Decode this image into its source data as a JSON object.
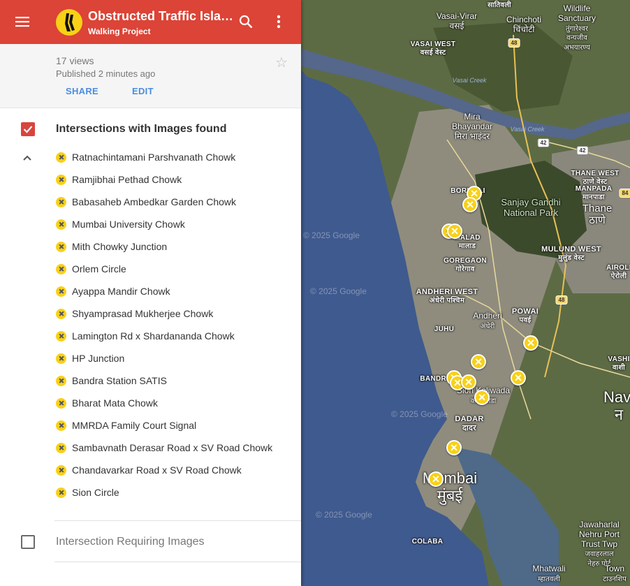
{
  "header": {
    "title": "Obstructed Traffic Isla…",
    "subtitle": "Walking Project",
    "menu_icon": "hamburger-menu-icon",
    "search_icon": "search-icon",
    "more_icon": "more-vert-icon",
    "color": "#db4437"
  },
  "info": {
    "views": "17 views",
    "published": "Published 2 minutes ago",
    "share_label": "SHARE",
    "edit_label": "EDIT",
    "star_icon": "star-outline-icon"
  },
  "layers": [
    {
      "title": "Intersections with Images found",
      "checked": true,
      "items": [
        "Ratnachintamani Parshvanath Chowk",
        "Ramjibhai Pethad Chowk",
        "Babasaheb Ambedkar Garden Chowk",
        "Mumbai University Chowk",
        "Mith Chowky Junction",
        "Orlem Circle",
        "Ayappa Mandir Chowk",
        "Shyamprasad Mukherjee Chowk",
        "Lamington Rd x Shardananda Chowk",
        "HP Junction",
        "Bandra Station SATIS",
        "Bharat Mata Chowk",
        "MMRDA Family Court Signal",
        "Sambavnath Derasar Road x SV Road Chowk",
        "Chandavarkar Road x SV Road Chowk",
        "Sion Circle"
      ]
    },
    {
      "title": "Intersection Requiring Images",
      "checked": false
    }
  ],
  "map": {
    "watermark": "© 2025 Google",
    "marker_color": "#f8d117",
    "places": {
      "vasai_virar": "Vasai-Virar",
      "vasai_virar_dev": "वसई",
      "satiwali": "सातिवली",
      "chinchoti": "Chinchoti",
      "chinchoti_dev": "चिंचोटी",
      "wildlife": "Wildlife",
      "sanctuary": "Sanctuary",
      "sanctuary_dev1": "तुंगारेश्वर",
      "sanctuary_dev2": "वन्यजीव",
      "sanctuary_dev3": "अभयारण्य",
      "vasai_west": "VASAI WEST",
      "vasai_west_dev": "वसई वेस्ट",
      "vasai_creek1": "Vasai Creek",
      "vasai_creek2": "Vasai Creek",
      "mira": "Mira",
      "bhayandar": "Bhayandar",
      "mira_dev": "मिरा भाइंदर",
      "thane_west": "THANE WEST",
      "thane_west_dev": "ठाणे वेस्ट",
      "manpada": "MANPADA",
      "manpada_dev": "मानपाडा",
      "sgnp1": "Sanjay Gandhi",
      "sgnp2": "National Park",
      "thane": "Thane",
      "thane_dev": "ठाणे",
      "borivali": "BORIVALI",
      "malad": "MALAD",
      "malad_dev": "मालाड",
      "goregaon": "GOREGAON",
      "goregaon_dev": "गोरेगाव",
      "mulund": "MULUND WEST",
      "mulund_dev": "मुलुंड वेस्ट",
      "airoli": "AIROLI",
      "airoli_dev": "ऐरोली",
      "andheri_west": "ANDHERI WEST",
      "andheri_west_dev": "अंधेरी पश्चिम",
      "andheri": "Andheri",
      "andheri_dev": "अंधेरी",
      "powai": "POWAI",
      "powai_dev": "पवई",
      "juhu": "JUHU",
      "vashi": "VASHI",
      "vashi_dev": "वाशी",
      "bandra": "BANDRA",
      "kolivada": "Sion Koliwada",
      "kolivada_dev": "कोळीवाडा",
      "navi": "Navi",
      "navi_dev": "न",
      "dadar": "DADAR",
      "dadar_dev": "दादर",
      "mumbai": "Mumbai",
      "mumbai_dev": "मुंबई",
      "jnpt1": "Jawaharlal",
      "jnpt2": "Nehru Port",
      "jnpt3": "Trust Twp",
      "jnpt_dev1": "जवाहरलाल",
      "jnpt_dev2": "नेहरु पोर्ट",
      "colaba": "COLABA",
      "mhatwali": "Mhatwali",
      "mhatwali_dev": "म्हातवली",
      "town": "Town",
      "town_dev": "टाउनशिप"
    },
    "shields": {
      "r48a": "48",
      "r42a": "42",
      "r42b": "42",
      "r48b": "48",
      "r48c": "48",
      "r84": "84"
    }
  }
}
